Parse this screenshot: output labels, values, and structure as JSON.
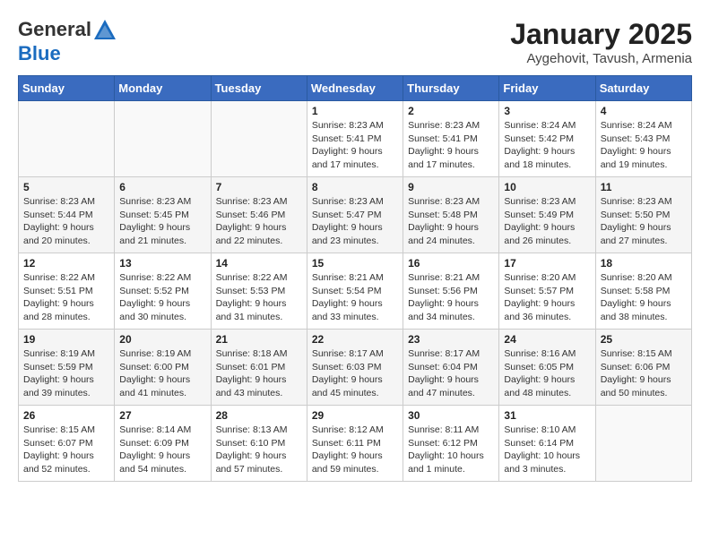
{
  "logo": {
    "general": "General",
    "blue": "Blue"
  },
  "title": "January 2025",
  "subtitle": "Aygehovit, Tavush, Armenia",
  "days_header": [
    "Sunday",
    "Monday",
    "Tuesday",
    "Wednesday",
    "Thursday",
    "Friday",
    "Saturday"
  ],
  "weeks": [
    [
      {
        "day": "",
        "info": ""
      },
      {
        "day": "",
        "info": ""
      },
      {
        "day": "",
        "info": ""
      },
      {
        "day": "1",
        "sunrise": "8:23 AM",
        "sunset": "5:41 PM",
        "daylight": "9 hours and 17 minutes."
      },
      {
        "day": "2",
        "sunrise": "8:23 AM",
        "sunset": "5:41 PM",
        "daylight": "9 hours and 17 minutes."
      },
      {
        "day": "3",
        "sunrise": "8:24 AM",
        "sunset": "5:42 PM",
        "daylight": "9 hours and 18 minutes."
      },
      {
        "day": "4",
        "sunrise": "8:24 AM",
        "sunset": "5:43 PM",
        "daylight": "9 hours and 19 minutes."
      }
    ],
    [
      {
        "day": "5",
        "sunrise": "8:23 AM",
        "sunset": "5:44 PM",
        "daylight": "9 hours and 20 minutes."
      },
      {
        "day": "6",
        "sunrise": "8:23 AM",
        "sunset": "5:45 PM",
        "daylight": "9 hours and 21 minutes."
      },
      {
        "day": "7",
        "sunrise": "8:23 AM",
        "sunset": "5:46 PM",
        "daylight": "9 hours and 22 minutes."
      },
      {
        "day": "8",
        "sunrise": "8:23 AM",
        "sunset": "5:47 PM",
        "daylight": "9 hours and 23 minutes."
      },
      {
        "day": "9",
        "sunrise": "8:23 AM",
        "sunset": "5:48 PM",
        "daylight": "9 hours and 24 minutes."
      },
      {
        "day": "10",
        "sunrise": "8:23 AM",
        "sunset": "5:49 PM",
        "daylight": "9 hours and 26 minutes."
      },
      {
        "day": "11",
        "sunrise": "8:23 AM",
        "sunset": "5:50 PM",
        "daylight": "9 hours and 27 minutes."
      }
    ],
    [
      {
        "day": "12",
        "sunrise": "8:22 AM",
        "sunset": "5:51 PM",
        "daylight": "9 hours and 28 minutes."
      },
      {
        "day": "13",
        "sunrise": "8:22 AM",
        "sunset": "5:52 PM",
        "daylight": "9 hours and 30 minutes."
      },
      {
        "day": "14",
        "sunrise": "8:22 AM",
        "sunset": "5:53 PM",
        "daylight": "9 hours and 31 minutes."
      },
      {
        "day": "15",
        "sunrise": "8:21 AM",
        "sunset": "5:54 PM",
        "daylight": "9 hours and 33 minutes."
      },
      {
        "day": "16",
        "sunrise": "8:21 AM",
        "sunset": "5:56 PM",
        "daylight": "9 hours and 34 minutes."
      },
      {
        "day": "17",
        "sunrise": "8:20 AM",
        "sunset": "5:57 PM",
        "daylight": "9 hours and 36 minutes."
      },
      {
        "day": "18",
        "sunrise": "8:20 AM",
        "sunset": "5:58 PM",
        "daylight": "9 hours and 38 minutes."
      }
    ],
    [
      {
        "day": "19",
        "sunrise": "8:19 AM",
        "sunset": "5:59 PM",
        "daylight": "9 hours and 39 minutes."
      },
      {
        "day": "20",
        "sunrise": "8:19 AM",
        "sunset": "6:00 PM",
        "daylight": "9 hours and 41 minutes."
      },
      {
        "day": "21",
        "sunrise": "8:18 AM",
        "sunset": "6:01 PM",
        "daylight": "9 hours and 43 minutes."
      },
      {
        "day": "22",
        "sunrise": "8:17 AM",
        "sunset": "6:03 PM",
        "daylight": "9 hours and 45 minutes."
      },
      {
        "day": "23",
        "sunrise": "8:17 AM",
        "sunset": "6:04 PM",
        "daylight": "9 hours and 47 minutes."
      },
      {
        "day": "24",
        "sunrise": "8:16 AM",
        "sunset": "6:05 PM",
        "daylight": "9 hours and 48 minutes."
      },
      {
        "day": "25",
        "sunrise": "8:15 AM",
        "sunset": "6:06 PM",
        "daylight": "9 hours and 50 minutes."
      }
    ],
    [
      {
        "day": "26",
        "sunrise": "8:15 AM",
        "sunset": "6:07 PM",
        "daylight": "9 hours and 52 minutes."
      },
      {
        "day": "27",
        "sunrise": "8:14 AM",
        "sunset": "6:09 PM",
        "daylight": "9 hours and 54 minutes."
      },
      {
        "day": "28",
        "sunrise": "8:13 AM",
        "sunset": "6:10 PM",
        "daylight": "9 hours and 57 minutes."
      },
      {
        "day": "29",
        "sunrise": "8:12 AM",
        "sunset": "6:11 PM",
        "daylight": "9 hours and 59 minutes."
      },
      {
        "day": "30",
        "sunrise": "8:11 AM",
        "sunset": "6:12 PM",
        "daylight": "10 hours and 1 minute."
      },
      {
        "day": "31",
        "sunrise": "8:10 AM",
        "sunset": "6:14 PM",
        "daylight": "10 hours and 3 minutes."
      },
      {
        "day": "",
        "info": ""
      }
    ]
  ]
}
